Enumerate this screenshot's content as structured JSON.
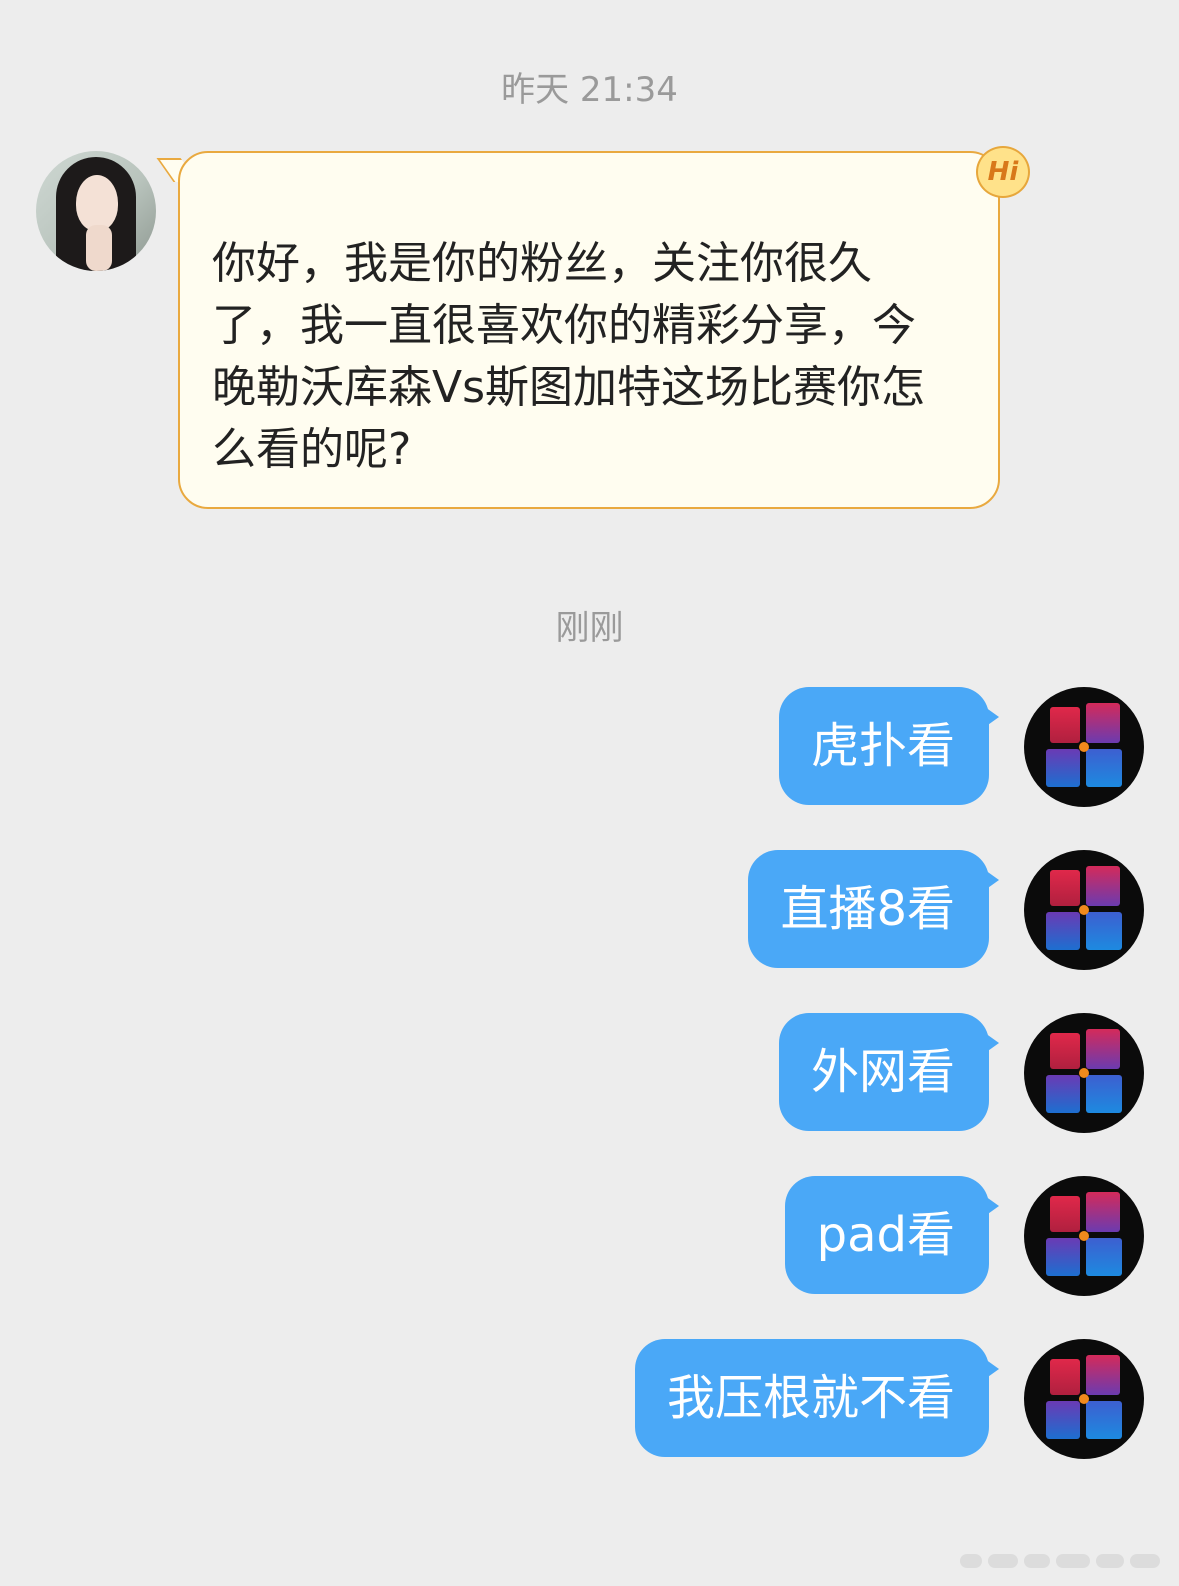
{
  "timestamps": {
    "yesterday": "昨天 21:34",
    "just_now": "刚刚"
  },
  "incoming": {
    "text": "你好，我是你的粉丝，关注你很久了，我一直很喜欢你的精彩分享，今晚勒沃库森Vs斯图加特这场比赛你怎么看的呢?",
    "badge": "Hi"
  },
  "outgoing": [
    {
      "text": "虎扑看"
    },
    {
      "text": "直播8看"
    },
    {
      "text": "外网看"
    },
    {
      "text": "pad看"
    },
    {
      "text": "我压根就不看"
    }
  ],
  "colors": {
    "background": "#ededed",
    "incoming_bubble": "#fffdf0",
    "incoming_border": "#e9a93f",
    "outgoing_bubble": "#4aa8f7",
    "timestamp": "#9a9a9a"
  },
  "icons": {
    "incoming_avatar": "user-avatar-icon",
    "outgoing_avatar": "team-logo-avatar-icon",
    "badge": "hi-badge-icon"
  }
}
